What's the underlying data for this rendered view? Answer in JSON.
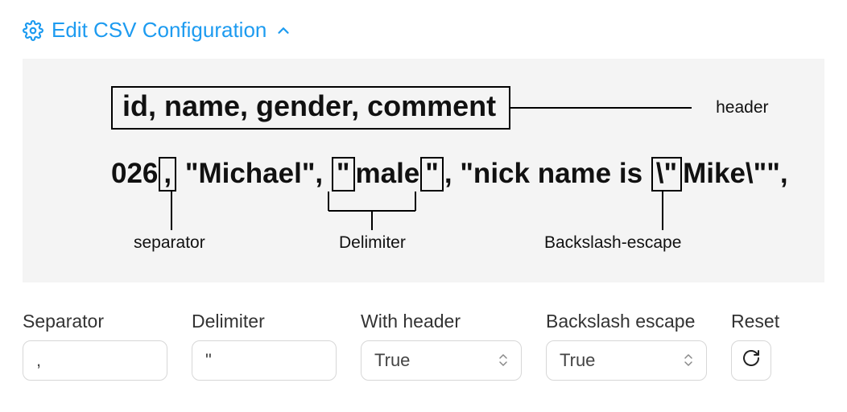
{
  "header": {
    "title": "Edit CSV Configuration"
  },
  "illustration": {
    "header_text": "id, name, gender, comment",
    "header_label": "header",
    "row": {
      "p0": "026",
      "sep": ",",
      "p1": " \"Michael\", ",
      "dq1": "\"",
      "p2": "male",
      "dq2": "\"",
      "p3": ", \"nick name is ",
      "esc": "\\\"",
      "p4": "Mike\\\"\","
    },
    "callouts": {
      "separator": "separator",
      "delimiter": "Delimiter",
      "escape": "Backslash-escape"
    }
  },
  "controls": {
    "separator": {
      "label": "Separator",
      "value": ","
    },
    "delimiter": {
      "label": "Delimiter",
      "value": "\""
    },
    "with_header": {
      "label": "With header",
      "value": "True"
    },
    "backslash_escape": {
      "label": "Backslash escape",
      "value": "True"
    },
    "reset": {
      "label": "Reset"
    }
  }
}
